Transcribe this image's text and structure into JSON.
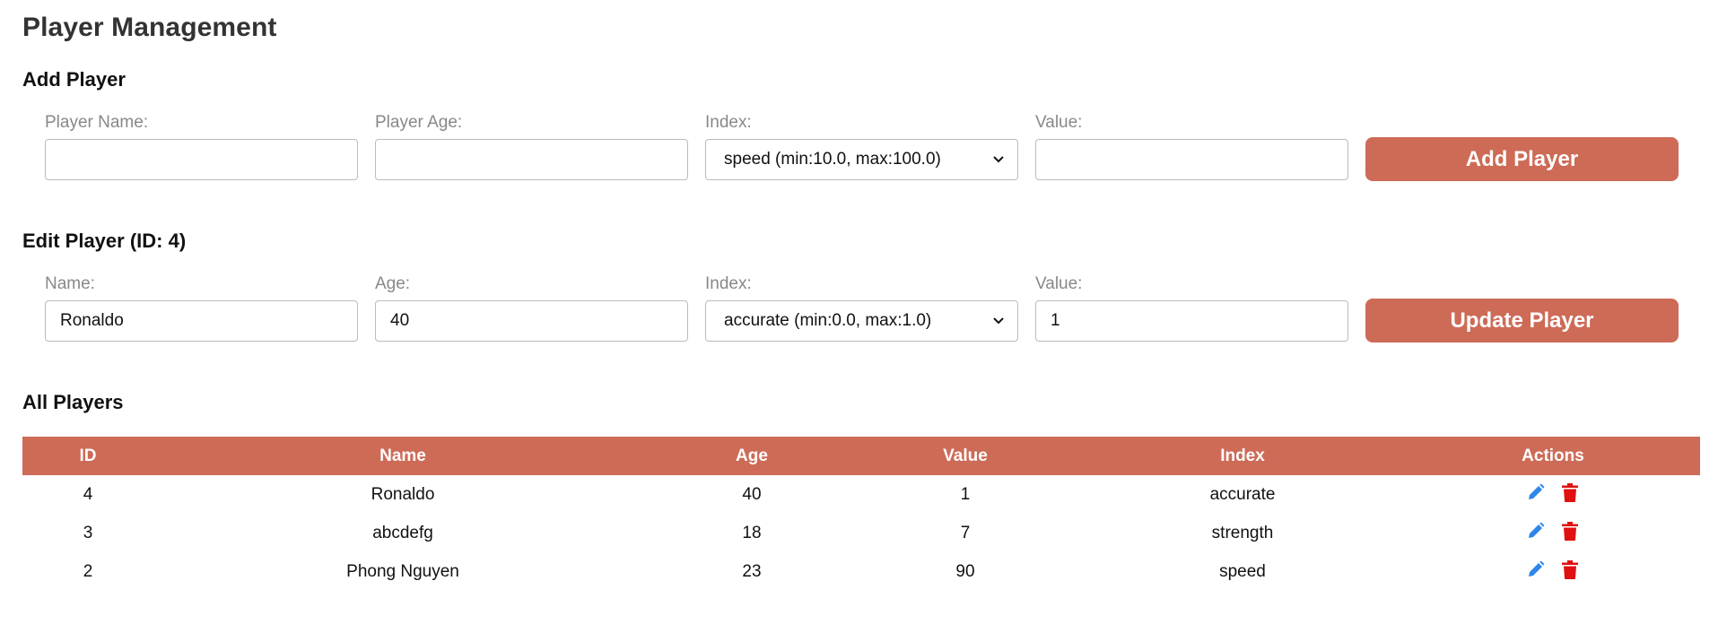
{
  "page_title": "Player Management",
  "add_player": {
    "heading": "Add Player",
    "name_label": "Player Name:",
    "name_value": "",
    "age_label": "Player Age:",
    "age_value": "",
    "index_label": "Index:",
    "index_selected": "speed (min:10.0, max:100.0)",
    "value_label": "Value:",
    "value_value": "",
    "button_label": "Add Player"
  },
  "edit_player": {
    "heading": "Edit Player (ID: 4)",
    "name_label": "Name:",
    "name_value": "Ronaldo",
    "age_label": "Age:",
    "age_value": "40",
    "index_label": "Index:",
    "index_selected": "accurate (min:0.0, max:1.0)",
    "value_label": "Value:",
    "value_value": "1",
    "button_label": "Update Player"
  },
  "all_players": {
    "heading": "All Players",
    "columns": [
      "ID",
      "Name",
      "Age",
      "Value",
      "Index",
      "Actions"
    ],
    "rows": [
      {
        "id": "4",
        "name": "Ronaldo",
        "age": "40",
        "value": "1",
        "index": "accurate"
      },
      {
        "id": "3",
        "name": "abcdefg",
        "age": "18",
        "value": "7",
        "index": "strength"
      },
      {
        "id": "2",
        "name": "Phong Nguyen",
        "age": "23",
        "value": "90",
        "index": "speed"
      }
    ]
  },
  "colors": {
    "accent": "#cd6b57",
    "edit_icon": "#2f86e8",
    "delete_icon": "#e01010"
  },
  "icons": {
    "edit": "pencil-icon",
    "delete": "trash-icon",
    "select": "chevron-down-icon"
  }
}
